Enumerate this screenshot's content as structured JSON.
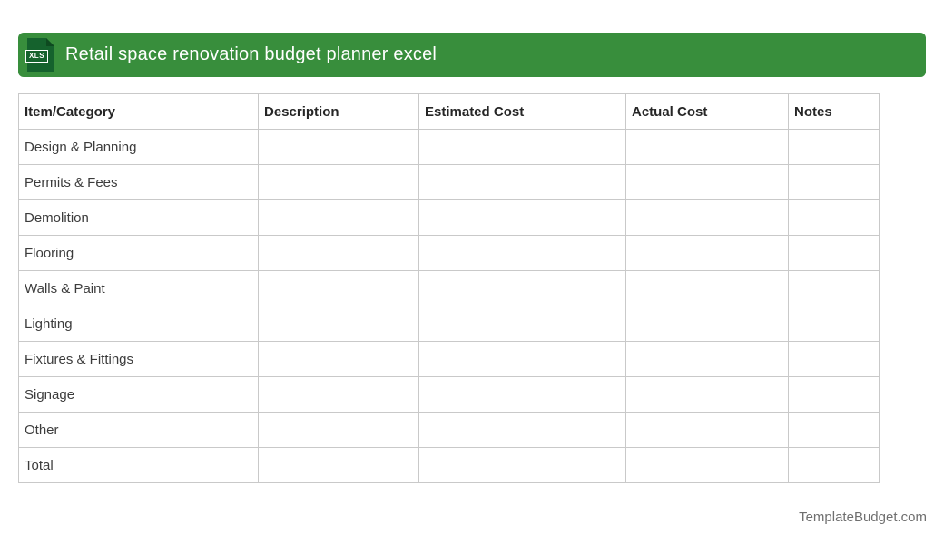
{
  "banner": {
    "title": "Retail space renovation budget planner excel",
    "icon_label": "XLS",
    "background_color": "#388e3c",
    "icon_color": "#15622d"
  },
  "table": {
    "columns": [
      "Item/Category",
      "Description",
      "Estimated Cost",
      "Actual Cost",
      "Notes"
    ],
    "rows": [
      {
        "item": "Design & Planning",
        "description": "",
        "estimated_cost": "",
        "actual_cost": "",
        "notes": ""
      },
      {
        "item": "Permits & Fees",
        "description": "",
        "estimated_cost": "",
        "actual_cost": "",
        "notes": ""
      },
      {
        "item": "Demolition",
        "description": "",
        "estimated_cost": "",
        "actual_cost": "",
        "notes": ""
      },
      {
        "item": "Flooring",
        "description": "",
        "estimated_cost": "",
        "actual_cost": "",
        "notes": ""
      },
      {
        "item": "Walls & Paint",
        "description": "",
        "estimated_cost": "",
        "actual_cost": "",
        "notes": ""
      },
      {
        "item": "Lighting",
        "description": "",
        "estimated_cost": "",
        "actual_cost": "",
        "notes": ""
      },
      {
        "item": "Fixtures & Fittings",
        "description": "",
        "estimated_cost": "",
        "actual_cost": "",
        "notes": ""
      },
      {
        "item": "Signage",
        "description": "",
        "estimated_cost": "",
        "actual_cost": "",
        "notes": ""
      },
      {
        "item": "Other",
        "description": "",
        "estimated_cost": "",
        "actual_cost": "",
        "notes": ""
      },
      {
        "item": "Total",
        "description": "",
        "estimated_cost": "",
        "actual_cost": "",
        "notes": ""
      }
    ]
  },
  "footer": {
    "text": "TemplateBudget.com"
  }
}
